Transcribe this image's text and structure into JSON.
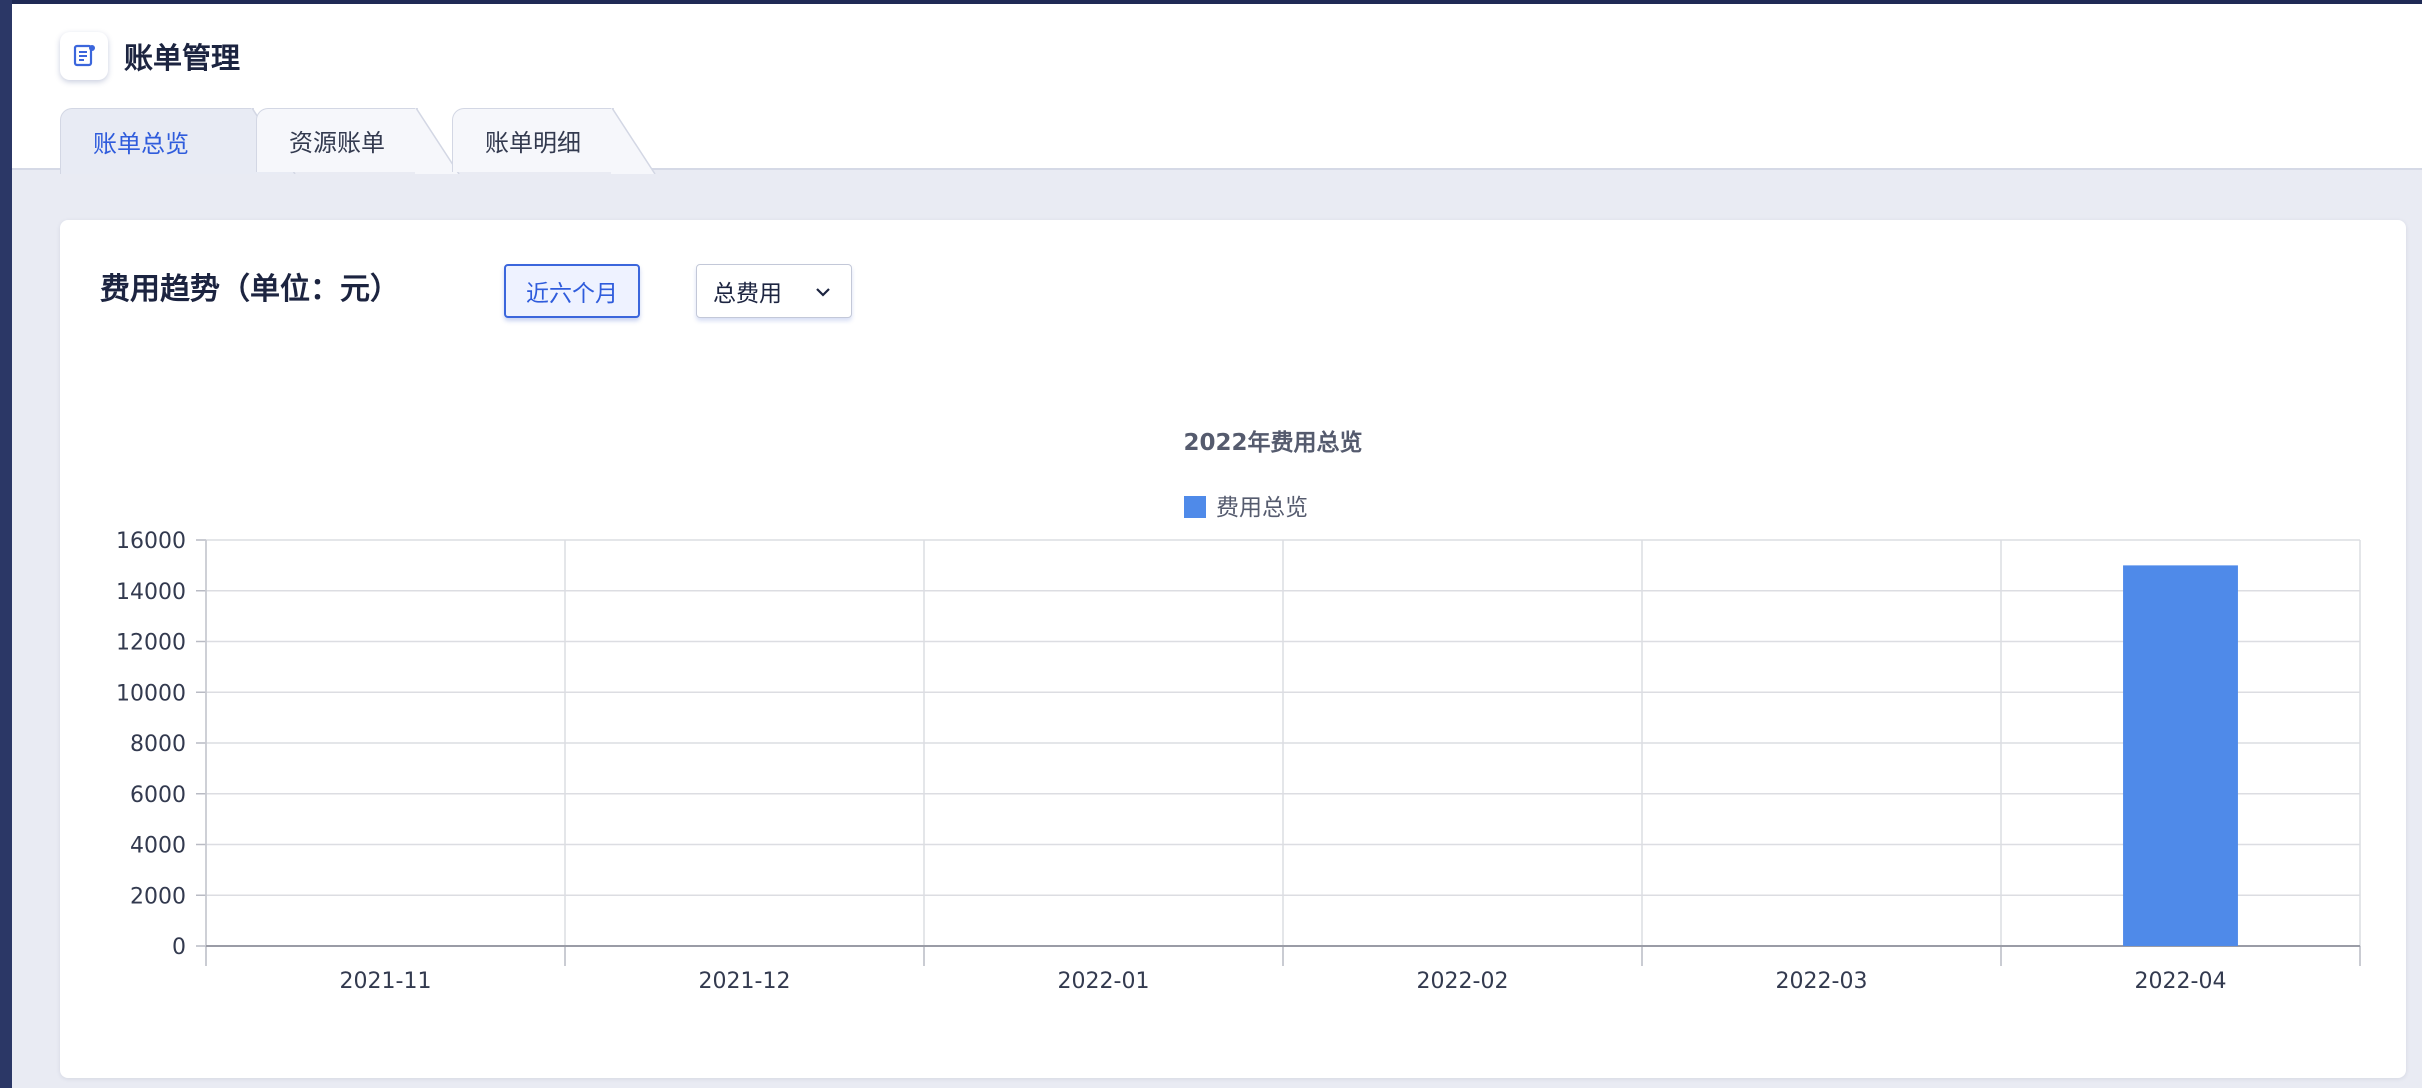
{
  "page": {
    "title": "账单管理"
  },
  "tabs": [
    {
      "label": "账单总览",
      "active": true
    },
    {
      "label": "资源账单",
      "active": false
    },
    {
      "label": "账单明细",
      "active": false
    }
  ],
  "card": {
    "title": "费用趋势（单位：元）",
    "range_button": "近六个月",
    "select_value": "总费用"
  },
  "colors": {
    "accent": "#2f5cdc",
    "bar": "#4f8ae9"
  },
  "chart_data": {
    "type": "bar",
    "title": "2022年费用总览",
    "legend": "费用总览",
    "categories": [
      "2021-11",
      "2021-12",
      "2022-01",
      "2022-02",
      "2022-03",
      "2022-04"
    ],
    "series": [
      {
        "name": "费用总览",
        "values": [
          0,
          0,
          0,
          0,
          0,
          15000
        ]
      }
    ],
    "ylim": [
      0,
      16000
    ],
    "yticks": [
      "0",
      "2000",
      "4000",
      "6000",
      "8000",
      "10000",
      "12000",
      "14000",
      "16000"
    ],
    "grid": true,
    "legend_position": "top-center"
  }
}
